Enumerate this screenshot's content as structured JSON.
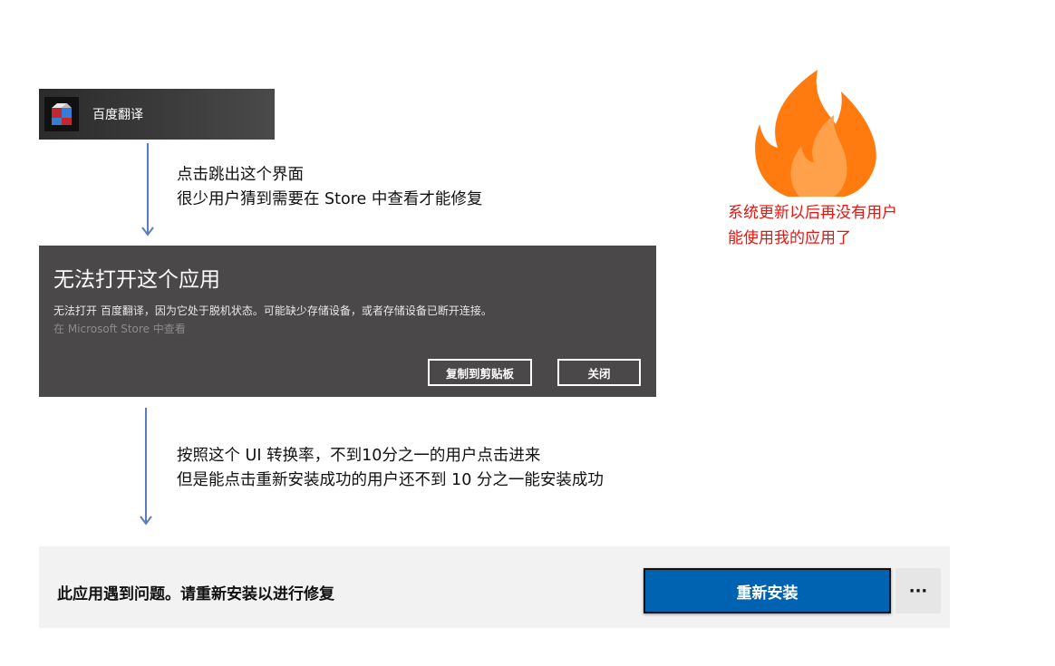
{
  "taskbar": {
    "app_name": "百度翻译"
  },
  "annotation_1": {
    "line1": "点击跳出这个界面",
    "line2": "很少用户猜到需要在 Store 中查看才能修复"
  },
  "annotation_2": {
    "line1": "按照这个 UI 转换率，不到10分之一的用户点击进来",
    "line2": "但是能点击重新安装成功的用户还不到 10 分之一能安装成功"
  },
  "side_note": {
    "line1": "系统更新以后再没有用户",
    "line2": "能使用我的应用了"
  },
  "dialog": {
    "title": "无法打开这个应用",
    "message": "无法打开 百度翻译，因为它处于脱机状态。可能缺少存储设备，或者存储设备已断开连接。",
    "store_link": "在 Microsoft Store 中查看",
    "copy_button": "复制到剪贴板",
    "close_button": "关闭"
  },
  "repair": {
    "message": "此应用遇到问题。请重新安装以进行修复",
    "reinstall_button": "重新安装",
    "more_button": "···"
  },
  "colors": {
    "dialog_bg": "#4a4848",
    "accent_blue": "#0063b1",
    "annotation_red": "#e8140e",
    "flame_orange": "#ff7a0f"
  }
}
